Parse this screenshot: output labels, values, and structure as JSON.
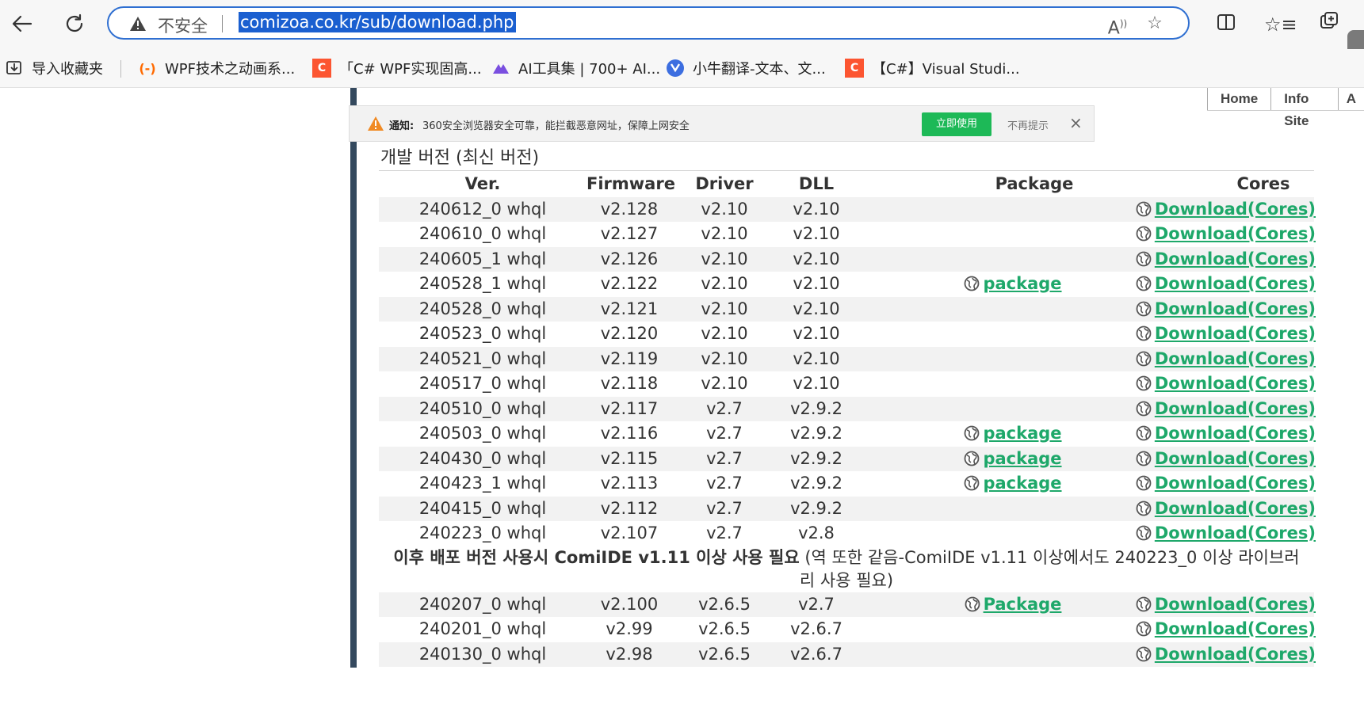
{
  "browser": {
    "insecure_label": "不安全",
    "url": "comizoa.co.kr/sub/download.php",
    "icons": {
      "back": "back-arrow-icon",
      "refresh": "refresh-icon",
      "read_aloud": "read-aloud-icon",
      "favorite": "star-icon",
      "split": "split-screen-icon",
      "favorites": "favorites-icon",
      "collections": "collections-icon"
    }
  },
  "bookmarks": [
    {
      "label": "导入收藏夹",
      "icon": "import-favorites-icon"
    },
    {
      "label": "WPF技术之动画系...",
      "icon": "aliyun-icon",
      "color": "#ff6a00"
    },
    {
      "label": "「C# WPF实现固高...",
      "icon": "csdn-icon",
      "color": "#fc5531"
    },
    {
      "label": "AI工具集 | 700+ AI...",
      "icon": "ai-tools-icon",
      "color": "#7a4fe0"
    },
    {
      "label": "小牛翻译-文本、文...",
      "icon": "niutrans-icon",
      "color": "#3c6ee0"
    },
    {
      "label": "【C#】Visual Studi...",
      "icon": "csdn-icon",
      "color": "#fc5531"
    }
  ],
  "site_nav": [
    "Home",
    "Info Site",
    "A"
  ],
  "notice": {
    "label": "通知:",
    "text": "360安全浏览器安全可靠，能拦截恶意网址，保障上网安全",
    "use_button": "立即使用",
    "dont_show": "不再提示",
    "close": "×"
  },
  "section_title": "개발 버전 (최신 버전)",
  "table": {
    "headers": {
      "ver": "Ver.",
      "firmware": "Firmware",
      "driver": "Driver",
      "dll": "DLL",
      "package": "Package",
      "cores": "Cores"
    },
    "rows_top": [
      {
        "ver": "240612_0 whql",
        "fw": "v2.128",
        "drv": "v2.10",
        "dll": "v2.10",
        "pkg": "",
        "core": "Download(Cores)"
      },
      {
        "ver": "240610_0 whql",
        "fw": "v2.127",
        "drv": "v2.10",
        "dll": "v2.10",
        "pkg": "",
        "core": "Download(Cores)"
      },
      {
        "ver": "240605_1 whql",
        "fw": "v2.126",
        "drv": "v2.10",
        "dll": "v2.10",
        "pkg": "",
        "core": "Download(Cores)"
      },
      {
        "ver": "240528_1 whql",
        "fw": "v2.122",
        "drv": "v2.10",
        "dll": "v2.10",
        "pkg": "package",
        "core": "Download(Cores)"
      },
      {
        "ver": "240528_0 whql",
        "fw": "v2.121",
        "drv": "v2.10",
        "dll": "v2.10",
        "pkg": "",
        "core": "Download(Cores)"
      },
      {
        "ver": "240523_0 whql",
        "fw": "v2.120",
        "drv": "v2.10",
        "dll": "v2.10",
        "pkg": "",
        "core": "Download(Cores)"
      },
      {
        "ver": "240521_0 whql",
        "fw": "v2.119",
        "drv": "v2.10",
        "dll": "v2.10",
        "pkg": "",
        "core": "Download(Cores)"
      },
      {
        "ver": "240517_0 whql",
        "fw": "v2.118",
        "drv": "v2.10",
        "dll": "v2.10",
        "pkg": "",
        "core": "Download(Cores)"
      },
      {
        "ver": "240510_0 whql",
        "fw": "v2.117",
        "drv": "v2.7",
        "dll": "v2.9.2",
        "pkg": "",
        "core": "Download(Cores)"
      },
      {
        "ver": "240503_0 whql",
        "fw": "v2.116",
        "drv": "v2.7",
        "dll": "v2.9.2",
        "pkg": "package",
        "core": "Download(Cores)"
      },
      {
        "ver": "240430_0 whql",
        "fw": "v2.115",
        "drv": "v2.7",
        "dll": "v2.9.2",
        "pkg": "package",
        "core": "Download(Cores)"
      },
      {
        "ver": "240423_1 whql",
        "fw": "v2.113",
        "drv": "v2.7",
        "dll": "v2.9.2",
        "pkg": "package",
        "core": "Download(Cores)"
      },
      {
        "ver": "240415_0 whql",
        "fw": "v2.112",
        "drv": "v2.7",
        "dll": "v2.9.2",
        "pkg": "",
        "core": "Download(Cores)"
      },
      {
        "ver": "240223_0 whql",
        "fw": "v2.107",
        "drv": "v2.7",
        "dll": "v2.8",
        "pkg": "",
        "core": "Download(Cores)"
      }
    ],
    "note_bold": "이후 배포 버전 사용시 ComiIDE v1.11 이상 사용 필요",
    "note_normal": " (역 또한 같음-ComiIDE v1.11 이상에서도 240223_0 이상 라이브러리 사용 필요)",
    "rows_bottom": [
      {
        "ver": "240207_0 whql",
        "fw": "v2.100",
        "drv": "v2.6.5",
        "dll": "v2.7",
        "pkg": "Package",
        "core": "Download(Cores)"
      },
      {
        "ver": "240201_0 whql",
        "fw": "v2.99",
        "drv": "v2.6.5",
        "dll": "v2.6.7",
        "pkg": "",
        "core": "Download(Cores)"
      },
      {
        "ver": "240130_0 whql",
        "fw": "v2.98",
        "drv": "v2.6.5",
        "dll": "v2.6.7",
        "pkg": "",
        "core": "Download(Cores)"
      }
    ]
  }
}
